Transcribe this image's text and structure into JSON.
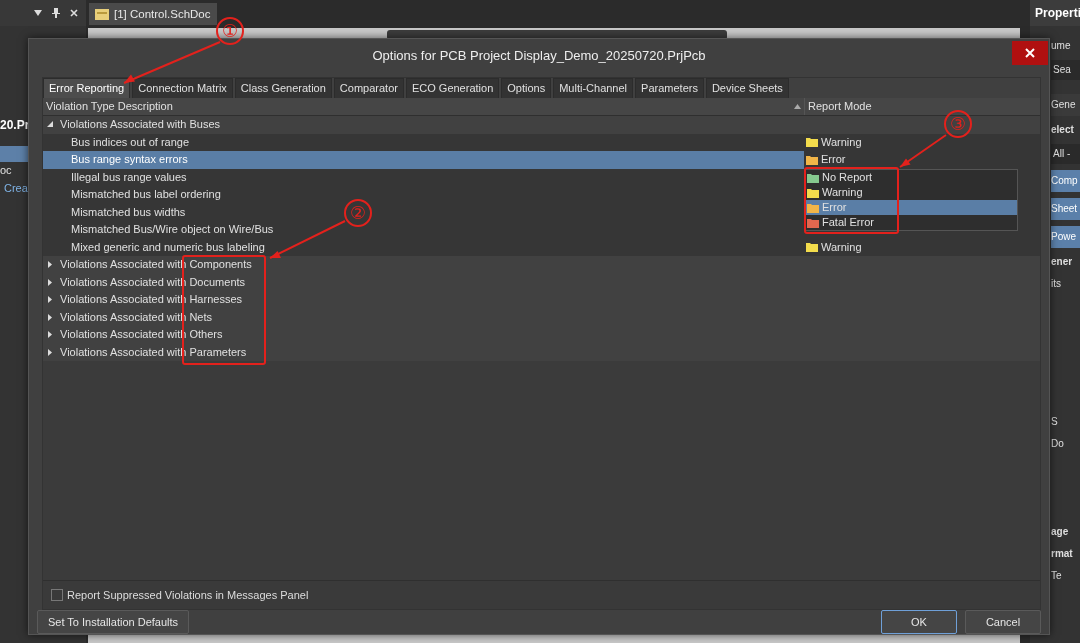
{
  "app": {
    "left_panel": {
      "items": [
        {
          "kind": "bold",
          "text": "20.Pr"
        },
        {
          "kind": "highlight"
        },
        {
          "kind": "text",
          "text": "oc"
        },
        {
          "kind": "link",
          "text": "Crea"
        }
      ]
    },
    "document_tab": {
      "label": "[1] Control.SchDoc"
    },
    "right_panel": {
      "title": "Properti",
      "items": [
        {
          "kind": "text",
          "text": "ume"
        },
        {
          "kind": "field",
          "text": "Sea"
        },
        {
          "kind": "section",
          "text": "Gene"
        },
        {
          "kind": "bold",
          "text": "elect"
        },
        {
          "kind": "field",
          "text": "All -"
        },
        {
          "kind": "button",
          "text": "Comp"
        },
        {
          "kind": "button",
          "text": "Sheet"
        },
        {
          "kind": "button",
          "text": "Powe"
        },
        {
          "kind": "bold",
          "text": "ener"
        },
        {
          "kind": "text",
          "text": "its"
        },
        {
          "kind": "gap"
        },
        {
          "kind": "text",
          "text": "S"
        },
        {
          "kind": "text",
          "text": "Do"
        },
        {
          "kind": "gap"
        },
        {
          "kind": "bold",
          "text": "age"
        },
        {
          "kind": "bold",
          "text": "rmat"
        },
        {
          "kind": "text",
          "text": "Te"
        }
      ]
    }
  },
  "dialog": {
    "title": "Options for PCB Project Display_Demo_20250720.PrjPcb",
    "tabs": [
      {
        "label": "Error Reporting",
        "selected": true
      },
      {
        "label": "Connection Matrix",
        "selected": false
      },
      {
        "label": "Class Generation",
        "selected": false
      },
      {
        "label": "Comparator",
        "selected": false
      },
      {
        "label": "ECO Generation",
        "selected": false
      },
      {
        "label": "Options",
        "selected": false
      },
      {
        "label": "Multi-Channel",
        "selected": false
      },
      {
        "label": "Parameters",
        "selected": false
      },
      {
        "label": "Device Sheets",
        "selected": false
      }
    ],
    "table": {
      "columns": [
        "Violation Type Description",
        "Report Mode"
      ],
      "groups": [
        {
          "label": "Violations Associated with Buses",
          "expanded": true,
          "children": [
            {
              "label": "Bus indices out of range",
              "selected": false,
              "mode": {
                "label": "Warning",
                "kind": "warning"
              }
            },
            {
              "label": "Bus range syntax errors",
              "selected": true,
              "mode": {
                "label": "Error",
                "kind": "error"
              },
              "dropdown": [
                {
                  "label": "No Report",
                  "kind": "none",
                  "selected": false
                },
                {
                  "label": "Warning",
                  "kind": "warning",
                  "selected": false
                },
                {
                  "label": "Error",
                  "kind": "error",
                  "selected": true
                },
                {
                  "label": "Fatal Error",
                  "kind": "fatal",
                  "selected": false
                }
              ]
            },
            {
              "label": "Illegal bus range values",
              "selected": false
            },
            {
              "label": "Mismatched bus label ordering",
              "selected": false
            },
            {
              "label": "Mismatched bus widths",
              "selected": false
            },
            {
              "label": "Mismatched Bus/Wire object on Wire/Bus",
              "selected": false
            },
            {
              "label": "Mixed generic and numeric bus labeling",
              "selected": false,
              "mode": {
                "label": "Warning",
                "kind": "warning"
              }
            }
          ]
        },
        {
          "label": "Violations Associated with Components",
          "expanded": false
        },
        {
          "label": "Violations Associated with Documents",
          "expanded": false
        },
        {
          "label": "Violations Associated with Harnesses",
          "expanded": false
        },
        {
          "label": "Violations Associated with Nets",
          "expanded": false
        },
        {
          "label": "Violations Associated with Others",
          "expanded": false
        },
        {
          "label": "Violations Associated with Parameters",
          "expanded": false
        }
      ]
    },
    "checkbox": {
      "label": "Report Suppressed Violations in Messages Panel",
      "checked": false
    },
    "buttons": [
      {
        "label": "Set To Installation Defaults",
        "kind": "left"
      },
      {
        "label": "OK",
        "kind": "default"
      },
      {
        "label": "Cancel",
        "kind": "normal"
      }
    ]
  },
  "annotations": [
    {
      "label": "①"
    },
    {
      "label": "②"
    },
    {
      "label": "③"
    }
  ]
}
